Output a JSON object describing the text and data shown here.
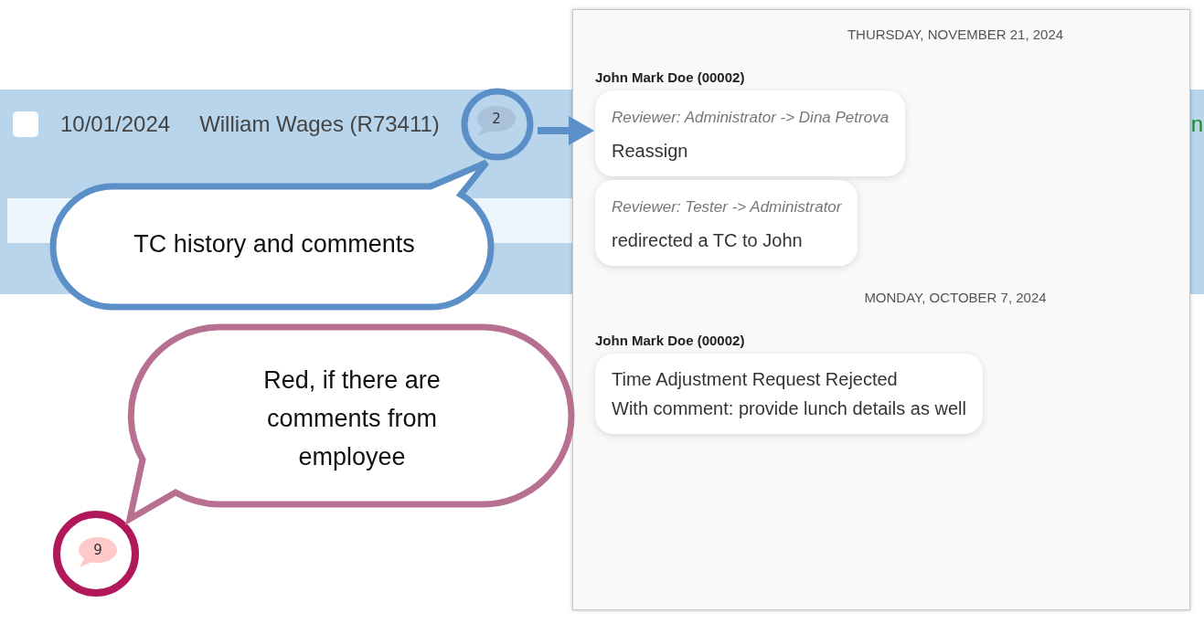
{
  "row": {
    "checked": false,
    "date": "10/01/2024",
    "employee": "William Wages (R73411)",
    "comments": {
      "count": "2",
      "from_employee": false
    },
    "column_4": "n"
  },
  "standalone_badge": {
    "count": "9",
    "from_employee": true
  },
  "annotations": [
    {
      "kind": "history",
      "text": "TC history and comments"
    },
    {
      "kind": "employee",
      "text": "Red, if there are comments from employee"
    }
  ],
  "history": [
    {
      "date": "THURSDAY, NOVEMBER 21, 2024",
      "author": "John Mark Doe (00002)",
      "messages": [
        {
          "meta": "Reviewer: Administrator -> Dina Petrova",
          "lines": [
            "Reassign"
          ]
        },
        {
          "meta": "Reviewer: Tester -> Administrator",
          "lines": [
            "redirected a TC to John"
          ]
        }
      ]
    },
    {
      "date": "MONDAY, OCTOBER 7, 2024",
      "author": "John Mark Doe (00002)",
      "messages": [
        {
          "lines": [
            "Time Adjustment Request Rejected",
            "With comment: provide lunch details as well"
          ]
        }
      ]
    }
  ]
}
